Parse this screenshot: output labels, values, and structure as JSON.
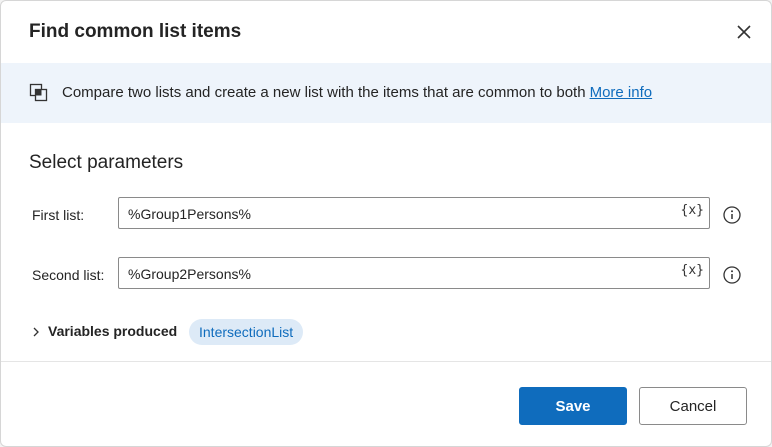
{
  "dialog": {
    "title": "Find common list items",
    "close_icon": "close-icon"
  },
  "info": {
    "icon": "compare-lists-icon",
    "text": "Compare two lists and create a new list with the items that are common to both",
    "link": "More info"
  },
  "section_title": "Select parameters",
  "fields": [
    {
      "label": "First list:",
      "value": "%Group1Persons%",
      "var_button": "{x}"
    },
    {
      "label": "Second list:",
      "value": "%Group2Persons%",
      "var_button": "{x}"
    }
  ],
  "variables": {
    "label": "Variables produced",
    "chip": "IntersectionList"
  },
  "buttons": {
    "save": "Save",
    "cancel": "Cancel"
  },
  "colors": {
    "accent": "#0f6cbd",
    "info_bg": "#eef4fb",
    "chip_bg": "#ddeaf7"
  }
}
